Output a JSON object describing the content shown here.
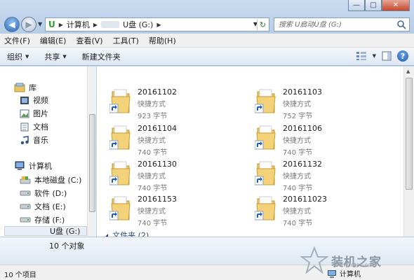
{
  "titlebar": {
    "minimize_glyph": "—",
    "maximize_glyph": "□",
    "close_glyph": "✕"
  },
  "address": {
    "breadcrumbs": [
      "计算机",
      "U盘 (G:)"
    ],
    "drive_logo": "U",
    "refresh_glyph": "↻",
    "forward_glyph": "▶",
    "back_glyph": "◀"
  },
  "search": {
    "placeholder": "搜索 U启动U盘 (G:)"
  },
  "menu": {
    "items": [
      "文件(F)",
      "编辑(E)",
      "查看(V)",
      "工具(T)",
      "帮助(H)"
    ]
  },
  "toolbar": {
    "organize": "组织",
    "share": "共享",
    "new_folder": "新建文件夹",
    "help": "?"
  },
  "nav": {
    "libraries": "库",
    "video": "视频",
    "pictures": "图片",
    "documents": "文档",
    "music": "音乐",
    "computer": "计算机",
    "drives": [
      "本地磁盘 (C:)",
      "软件 (D:)",
      "文档 (E:)",
      "存储 (F:)",
      "U盘 (G:)"
    ]
  },
  "files": [
    {
      "name": "20161102",
      "type": "快捷方式",
      "size": "923 字节"
    },
    {
      "name": "20161103",
      "type": "快捷方式",
      "size": "752 字节"
    },
    {
      "name": "20161104",
      "type": "快捷方式",
      "size": "740 字节"
    },
    {
      "name": "20161106",
      "type": "快捷方式",
      "size": "740 字节"
    },
    {
      "name": "20161130",
      "type": "快捷方式",
      "size": "740 字节"
    },
    {
      "name": "20161132",
      "type": "快捷方式",
      "size": "740 字节"
    },
    {
      "name": "20161153",
      "type": "快捷方式",
      "size": "740 字节"
    },
    {
      "name": "201611023",
      "type": "快捷方式",
      "size": "740 字节"
    }
  ],
  "group_header": "文件夹 (2)",
  "details": {
    "object_count": "10 个对象"
  },
  "status": {
    "items": "10 个项目",
    "location": "计算机"
  },
  "watermark": {
    "text": "装机之家",
    "url": "www.lotpc.com"
  },
  "colors": {
    "folder": "#f3d27a",
    "shortcut_arrow": "#1d5fbf",
    "selection": "#e9eef6"
  }
}
